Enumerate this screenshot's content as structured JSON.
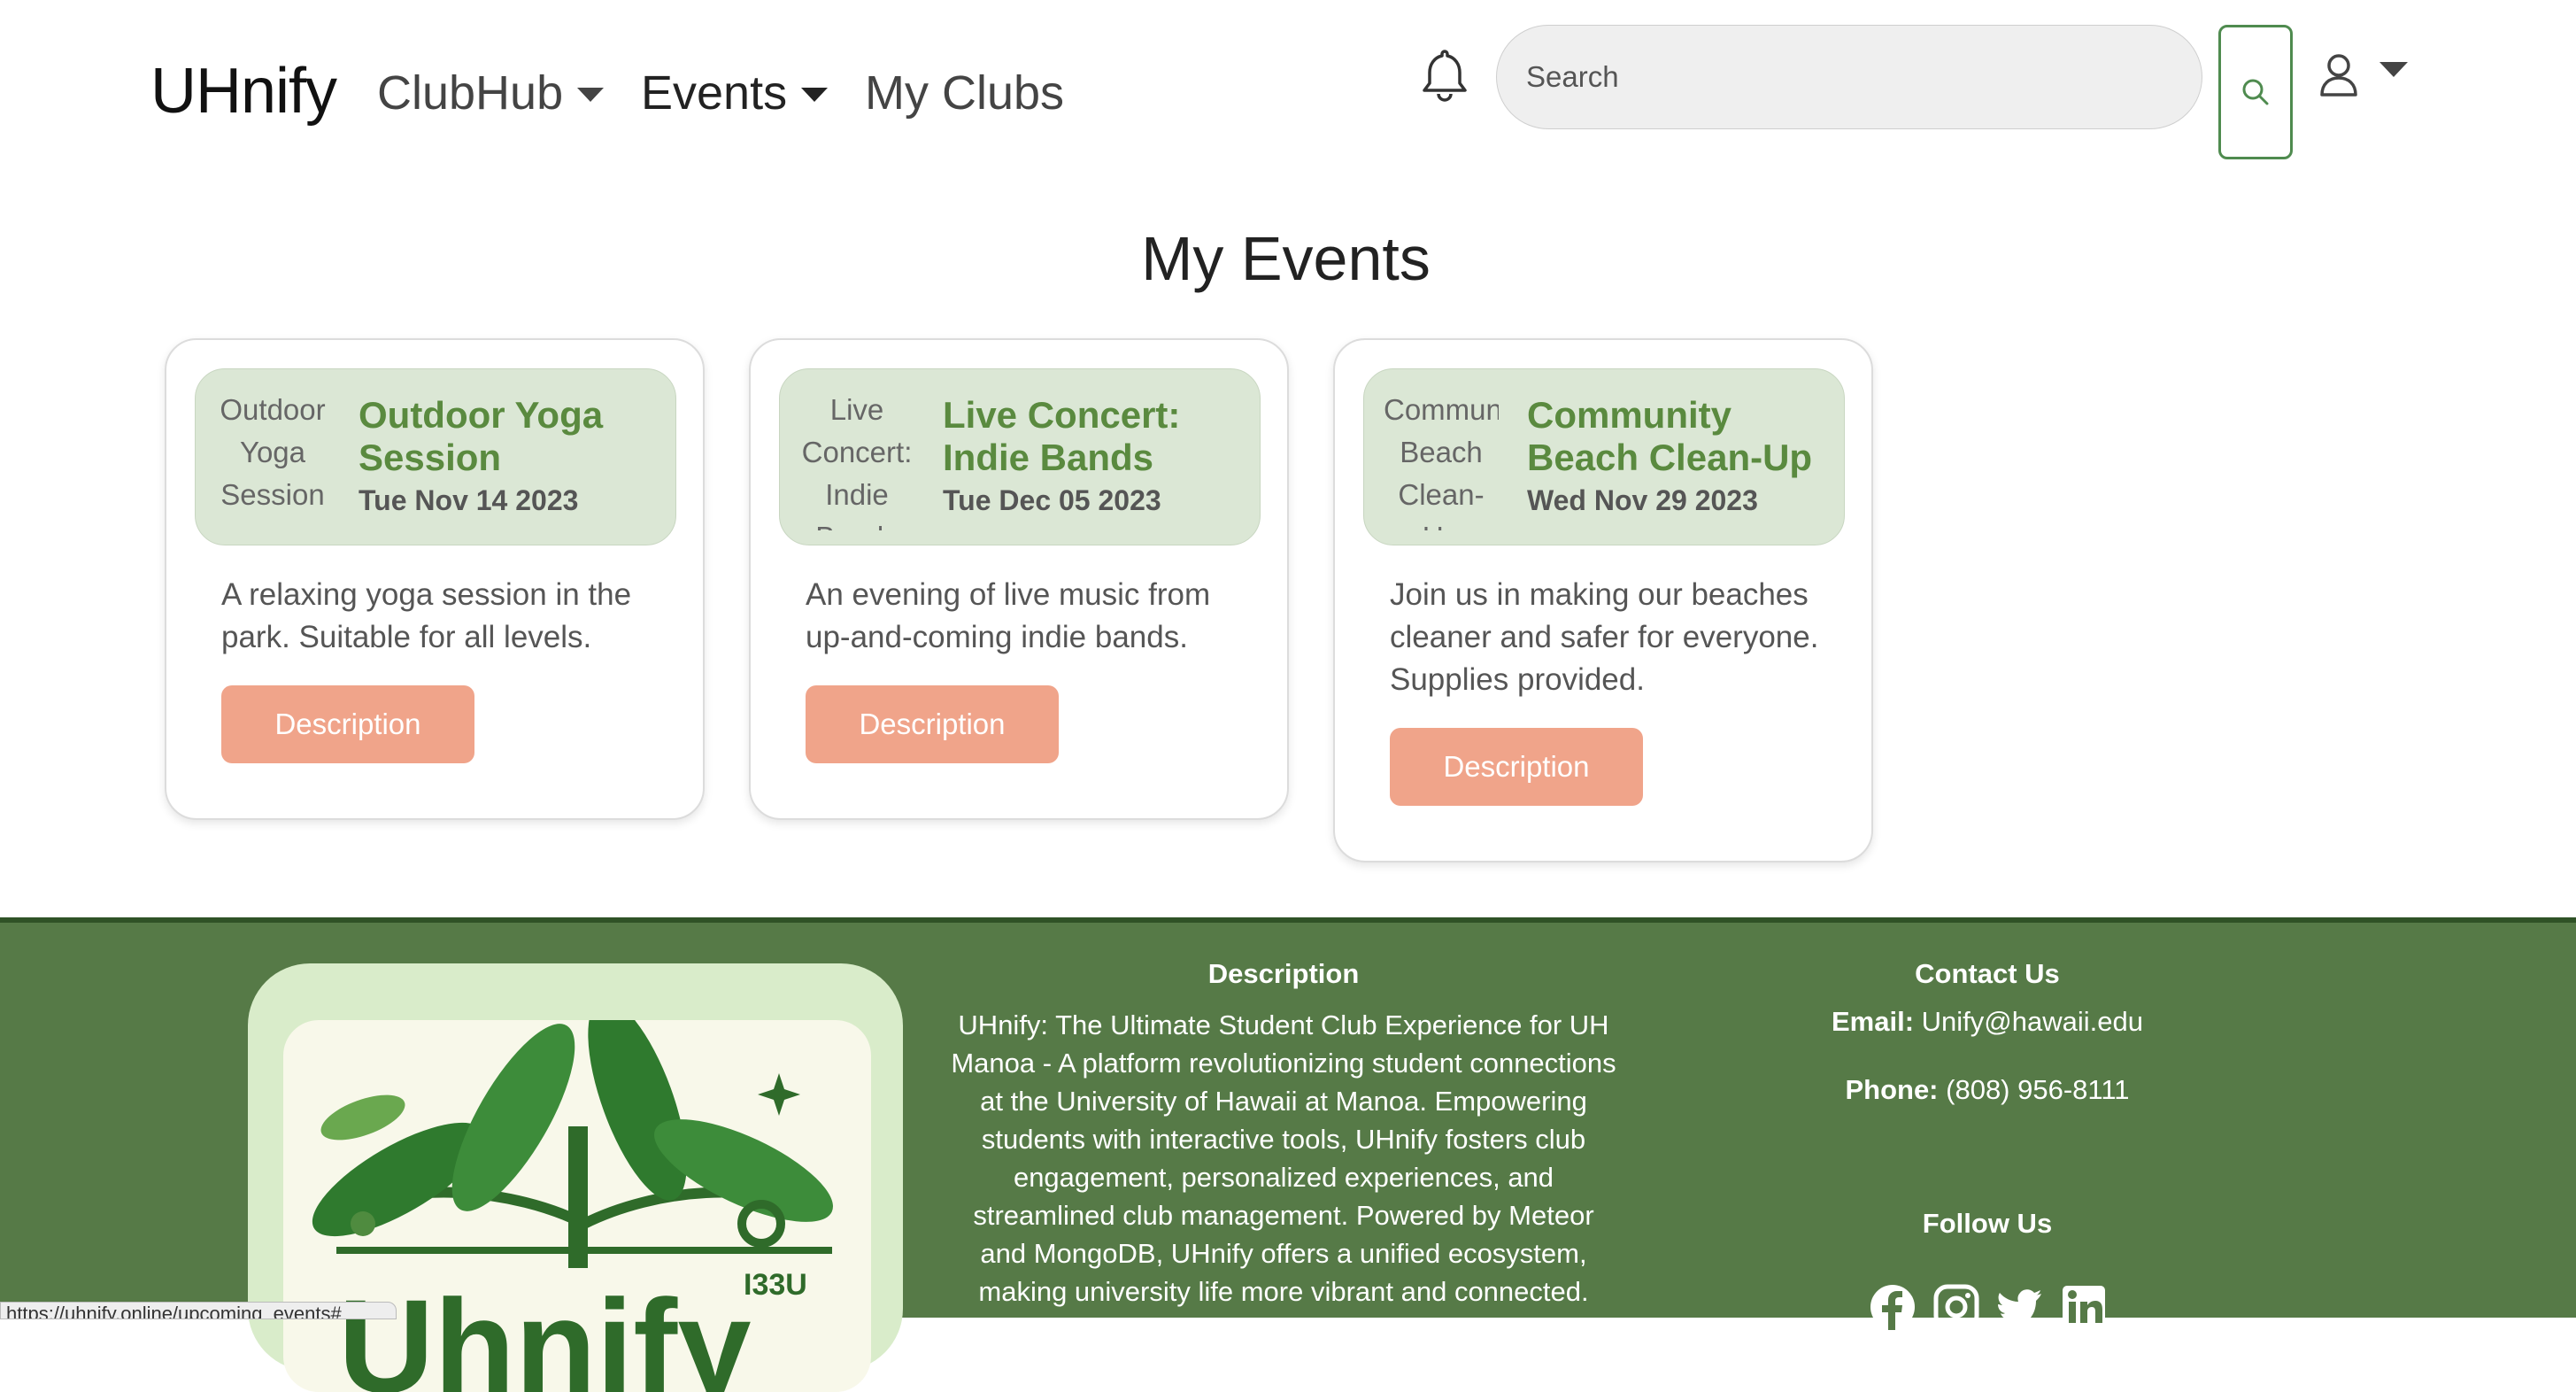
{
  "nav": {
    "brand": "UHnify",
    "clubhub": "ClubHub",
    "events": "Events",
    "my_clubs": "My Clubs",
    "search_placeholder": "Search"
  },
  "page": {
    "title": "My Events"
  },
  "events": [
    {
      "image_alt": "Outdoor Yoga Session",
      "title": "Outdoor Yoga Session",
      "date": "Tue Nov 14 2023",
      "description": "A relaxing yoga session in the park. Suitable for all levels.",
      "button": "Description"
    },
    {
      "image_alt": "Live Concert: Indie Bands",
      "title": "Live Concert: Indie Bands",
      "date": "Tue Dec 05 2023",
      "description": "An evening of live music from up-and-coming indie bands.",
      "button": "Description"
    },
    {
      "image_alt": "Community Beach Clean-Up",
      "title": "Community Beach Clean-Up",
      "date": "Wed Nov 29 2023",
      "description": "Join us in making our beaches cleaner and safer for everyone. Supplies provided.",
      "button": "Description"
    }
  ],
  "footer": {
    "logo_text": "Uhnify",
    "logo_sub": "I33U",
    "description_heading": "Description",
    "description": "UHnify: The Ultimate Student Club Experience for UH Manoa - A platform revolutionizing student connections at the University of Hawaii at Manoa. Empowering students with interactive tools, UHnify fosters club engagement, personalized experiences, and streamlined club management. Powered by Meteor and MongoDB, UHnify offers a unified ecosystem, making university life more vibrant and connected.",
    "contact_heading": "Contact Us",
    "email_label": "Email:",
    "email": "Unify@hawaii.edu",
    "phone_label": "Phone:",
    "phone": "(808) 956-8111",
    "follow_heading": "Follow Us",
    "socials": [
      "facebook-icon",
      "instagram-icon",
      "twitter-icon",
      "linkedin-icon"
    ]
  },
  "status_bar": {
    "url": "https://uhnify.online/upcoming_events#"
  },
  "colors": {
    "accent_green": "#5a8a3f",
    "card_header_bg": "#dbe7d5",
    "button_salmon": "#f0a48a",
    "footer_bg": "#567a47"
  }
}
